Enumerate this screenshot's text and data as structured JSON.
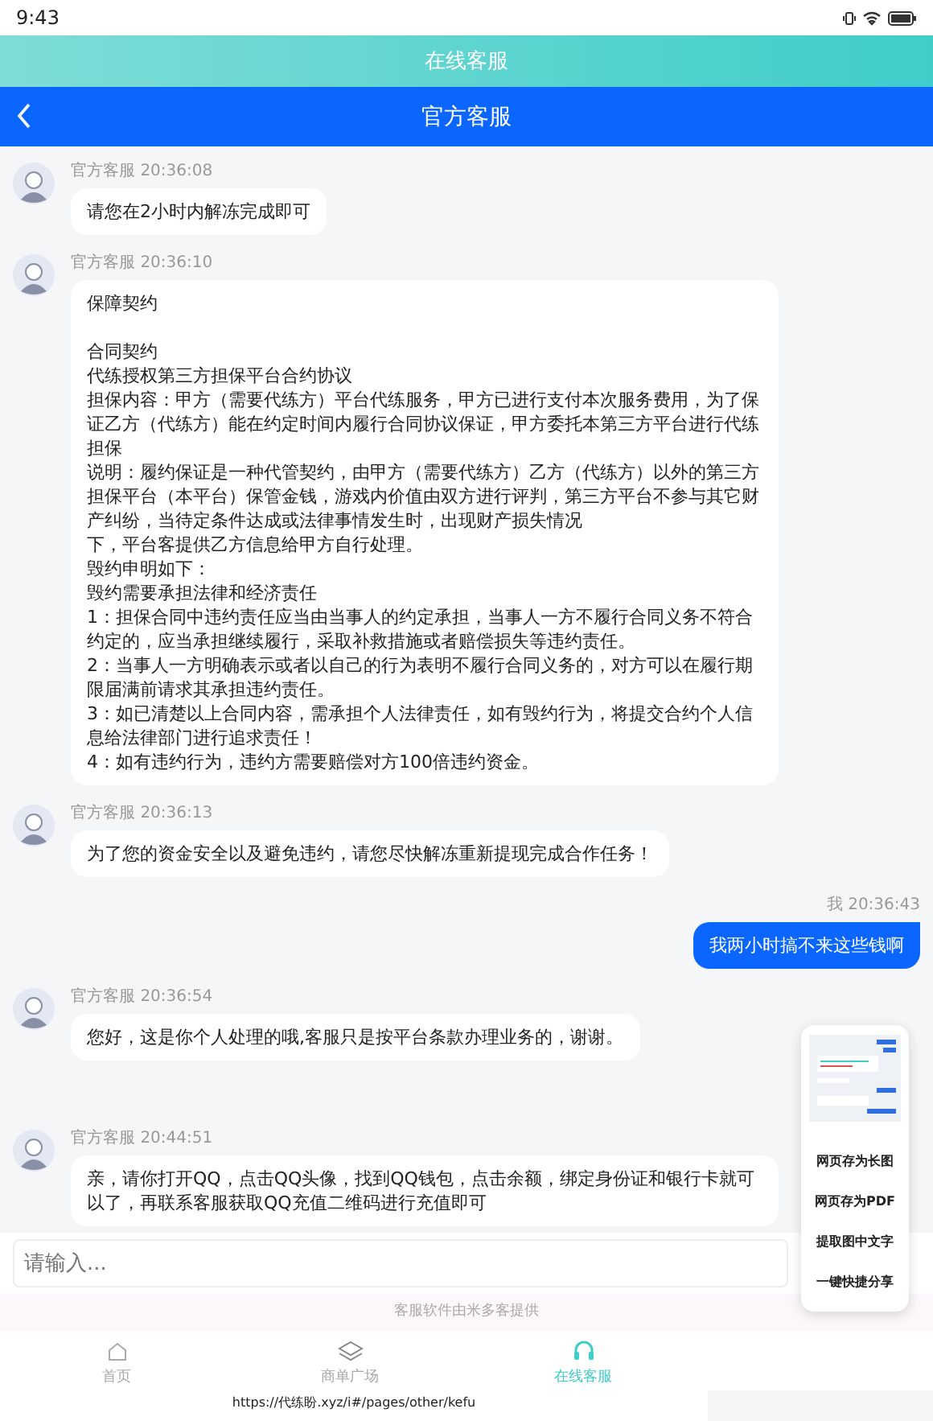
{
  "status_bar": {
    "time": "9:43"
  },
  "header": {
    "title": "在线客服"
  },
  "nav_bar": {
    "title": "官方客服"
  },
  "messages": [
    {
      "kind": "incoming",
      "sender": "官方客服",
      "time": "20:36:08",
      "paragraphs": [
        "请您在2小时内解冻完成即可"
      ]
    },
    {
      "kind": "incoming",
      "sender": "官方客服",
      "time": "20:36:10",
      "paragraphs": [
        [
          "保障契约"
        ],
        [
          "合同契约",
          "代练授权第三方担保平台合约协议",
          "担保内容：甲方（需要代练方）平台代练服务，甲方已进行支付本次服务费用，为了保证乙方（代练方）能在约定时间内履行合同协议保证，甲方委托本第三方平台进行代练担保",
          "说明：履约保证是一种代管契约，由甲方（需要代练方）乙方（代练方）以外的第三方担保平台（本平台）保管金钱，游戏内价值由双方进行评判，第三方平台不参与其它财产纠纷，当待定条件达成或法律事情发生时，出现财产损失情况",
          "下，平台客提供乙方信息给甲方自行处理。",
          "毁约申明如下：",
          "毁约需要承担法律和经济责任",
          "1：担保合同中违约责任应当由当事人的约定承担，当事人一方不履行合同义务不符合约定的，应当承担继续履行，采取补救措施或者赔偿损失等违约责任。",
          "2：当事人一方明确表示或者以自己的行为表明不履行合同义务的，对方可以在履行期限届满前请求其承担违约责任。",
          "3：如已清楚以上合同内容，需承担个人法律责任，如有毁约行为，将提交合约个人信息给法律部门进行追求责任！",
          "4：如有违约行为，违约方需要赔偿对方100倍违约资金。"
        ]
      ]
    },
    {
      "kind": "incoming",
      "sender": "官方客服",
      "time": "20:36:13",
      "paragraphs": [
        "为了您的资金安全以及避免违约，请您尽快解冻重新提现完成合作任务！"
      ]
    },
    {
      "kind": "outgoing",
      "sender": "我",
      "time": "20:36:43",
      "paragraphs": [
        "我两小时搞不来这些钱啊"
      ]
    },
    {
      "kind": "incoming",
      "sender": "官方客服",
      "time": "20:36:54",
      "paragraphs": [
        "您好，这是你个人处理的哦,客服只是按平台条款办理业务的，谢谢。"
      ]
    },
    {
      "kind": "incoming",
      "sender": "官方客服",
      "time": "20:44:51",
      "paragraphs": [
        "亲，请你打开QQ，点击QQ头像，找到QQ钱包，点击余额，绑定身份证和银行卡就可以了，再联系客服获取QQ充值二维码进行充值即可"
      ]
    }
  ],
  "input": {
    "placeholder": "请输入..."
  },
  "provider_note": "客服软件由米多客提供",
  "tabs": [
    {
      "label": "首页",
      "kind": "home",
      "selected": false
    },
    {
      "label": "商单广场",
      "kind": "layers",
      "selected": false
    },
    {
      "label": "在线客服",
      "kind": "headset",
      "selected": true
    }
  ],
  "url": "https://代练盼.xyz/i#/pages/other/kefu",
  "share_menu": {
    "items": [
      "网页存为长图",
      "网页存为PDF",
      "提取图中文字",
      "一键快捷分享"
    ]
  }
}
